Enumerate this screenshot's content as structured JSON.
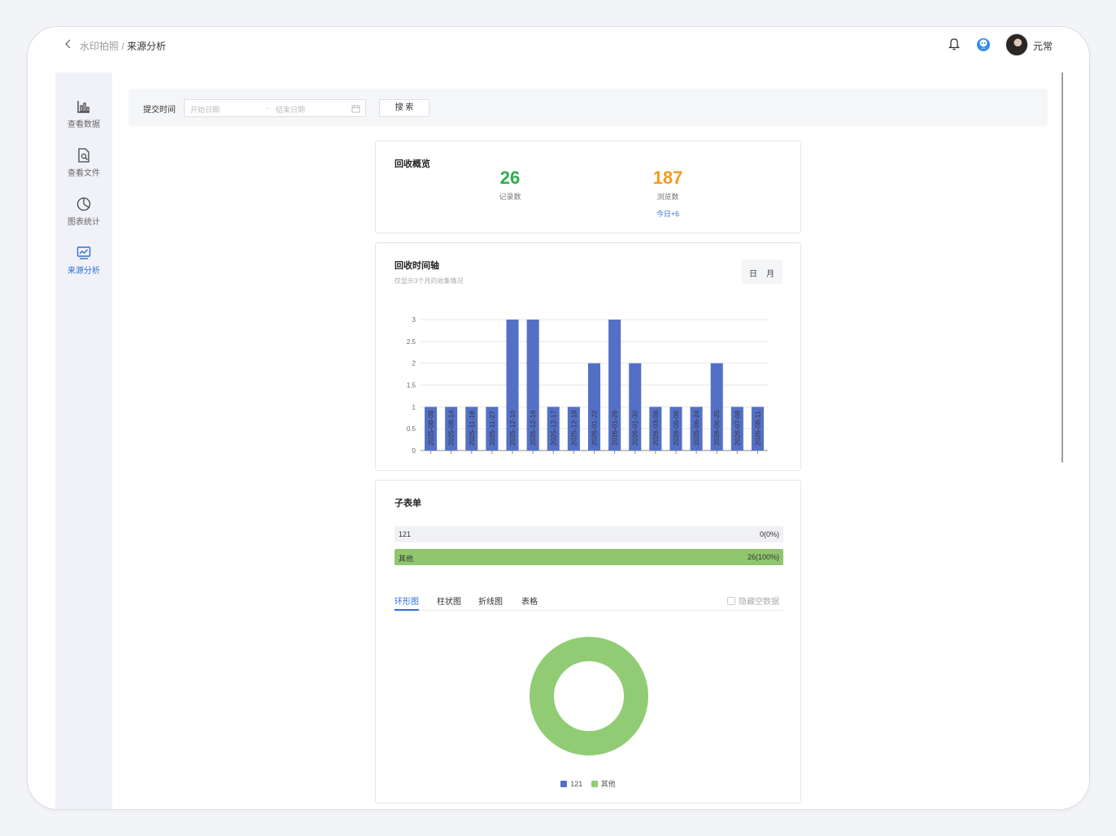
{
  "breadcrumb": {
    "parent": "水印拍照",
    "separator": " / ",
    "current": "来源分析"
  },
  "user": {
    "name": "元常"
  },
  "sidebar": {
    "items": [
      {
        "label": "查看数据",
        "icon": "bar-chart-icon"
      },
      {
        "label": "查看文件",
        "icon": "file-search-icon"
      },
      {
        "label": "图表统计",
        "icon": "pie-chart-icon"
      },
      {
        "label": "来源分析",
        "icon": "line-chart-icon",
        "active": true
      }
    ]
  },
  "filter": {
    "label": "提交时间",
    "start_placeholder": "开始日期",
    "separator": "-",
    "end_placeholder": "结束日期",
    "search_label": "搜 索"
  },
  "overview": {
    "title": "回收概览",
    "records_value": "26",
    "records_label": "记录数",
    "views_value": "187",
    "views_label": "浏览数",
    "today": "今日+6",
    "colors": {
      "records": "#2fad4d",
      "views": "#f39a1e"
    }
  },
  "timeline": {
    "title": "回收时间轴",
    "subtitle": "仅显示3个月的收集情况",
    "toggle_day": "日",
    "toggle_month": "月"
  },
  "chart_data": {
    "type": "bar",
    "categories": [
      "2025-08-08",
      "2025-08-14",
      "2025-11-18",
      "2025-11-27",
      "2025-12-10",
      "2025-12-16",
      "2025-12-17",
      "2025-12-18",
      "2026-01-22",
      "2026-01-26",
      "2026-01-30",
      "2026-03-06",
      "2026-05-06",
      "2026-06-24",
      "2026-06-25",
      "2026-07-08",
      "2026-08-11"
    ],
    "values": [
      1,
      1,
      1,
      1,
      3,
      3,
      1,
      1,
      2,
      3,
      2,
      1,
      1,
      1,
      2,
      1,
      1
    ],
    "yticks": [
      "0",
      "0.5",
      "1",
      "1.5",
      "2",
      "2.5",
      "3"
    ],
    "ylim": [
      0,
      3
    ],
    "grid": true,
    "bar_color": "#5470c6"
  },
  "subform": {
    "title": "子表单",
    "rows": [
      {
        "label": "121",
        "value": "0(0%)",
        "fraction": 0
      },
      {
        "label": "其他",
        "value": "26(100%)",
        "fraction": 1
      }
    ],
    "tabs": [
      "环形图",
      "柱状图",
      "折线图",
      "表格"
    ],
    "active_tab": 0,
    "hide_empty_label": "隐藏空数据"
  },
  "donut_data": {
    "type": "pie",
    "slices": [
      {
        "name": "121",
        "value": 0,
        "color": "#5470c6"
      },
      {
        "name": "其他",
        "value": 26,
        "color": "#91cc75"
      }
    ]
  }
}
